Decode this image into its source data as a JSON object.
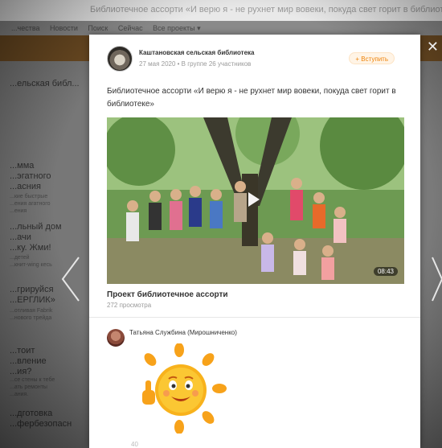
{
  "window": {
    "title": "Библиотечное ассорти «И верю я - не рухнет мир вовеки, покуда свет горит в библиотеке»"
  },
  "background": {
    "nav": [
      "...чества",
      "Новости",
      "Поиск",
      "Сейчас",
      "Все проекты ▾"
    ],
    "left_items": [
      {
        "title": "...ельская библ..."
      },
      {
        "title": "...мма\n...эгатного\n...асния",
        "sub": "...кие быстрые\n...ения агатного\n...ения"
      },
      {
        "title": "...льный дом\n...ачи\n...ку. Жми!",
        "sub": "...детей\n...книт-wing кесь"
      },
      {
        "title": "...грируйся\n...ЕРГЛИК»",
        "sub": "...отливая Fabrik\n...нового трейда"
      },
      {
        "title": "...тоит\n...вление\n...ия?",
        "sub": "...се стены к тебе\n...ать ремонты\n...ания."
      },
      {
        "title": "...дготовка\n...фербезопасн"
      }
    ]
  },
  "post": {
    "group_name": "Каштановская сельская библиотека",
    "date": "27 мая 2020",
    "meta_tail": " • В группе 26 участников",
    "join_label": "+ Вступить",
    "text": "Библиотечное ассорти «И верю я - не рухнет мир вовеки, покуда свет горит в библиотеке»",
    "video": {
      "duration": "08:43",
      "title": "Проект библиотечное ассорти",
      "views": "272 просмотра"
    },
    "comment": {
      "author": "Татьяна Службина (Мирошниченко)",
      "sticker_icon": "smiling-sun-thumbs-up-sticker"
    },
    "bottom_hint": "40"
  },
  "colors": {
    "accent_orange": "#ee8208",
    "modal_bg": "#ffffff"
  }
}
